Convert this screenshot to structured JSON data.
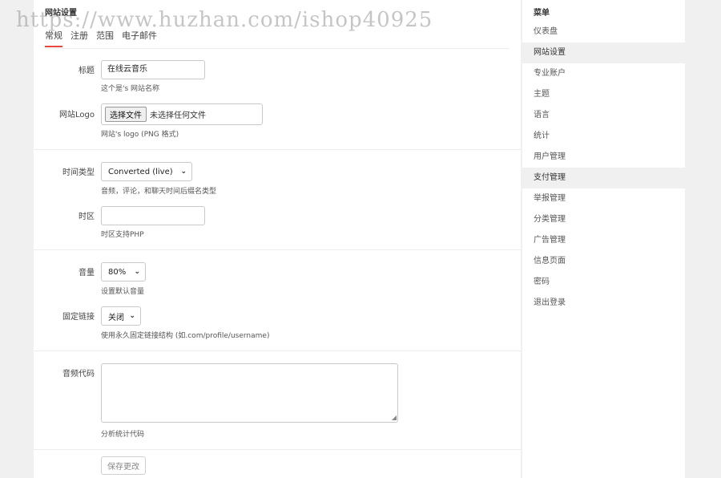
{
  "header": {
    "title": "网站设置"
  },
  "tabs": [
    {
      "label": "常规",
      "active": true
    },
    {
      "label": "注册"
    },
    {
      "label": "范围"
    },
    {
      "label": "电子邮件"
    }
  ],
  "form": {
    "title_field": {
      "label": "标题",
      "value": "在线云音乐",
      "hint": "这个是's 网站名称"
    },
    "logo_field": {
      "label": "网站Logo",
      "button": "选择文件",
      "file_text": "未选择任何文件",
      "hint": "网站's logo (PNG 格式)"
    },
    "time_type": {
      "label": "时间类型",
      "value": "Converted (live)",
      "hint": "音频，评论，和聊天时间后缀名类型"
    },
    "timezone": {
      "label": "时区",
      "value": "",
      "hint": "时区支持PHP"
    },
    "volume": {
      "label": "音量",
      "value": "80%",
      "hint": "设置默认音量"
    },
    "permalink": {
      "label": "固定链接",
      "value": "关闭",
      "hint": "使用永久固定链接结构 (如.com/profile/username)"
    },
    "audio_code": {
      "label": "音频代码",
      "value": "",
      "hint": "分析统计代码"
    },
    "save_label": "保存更改"
  },
  "sidebar": {
    "title": "菜单",
    "items": [
      {
        "label": "仪表盘"
      },
      {
        "label": "网站设置",
        "highlight": true
      },
      {
        "label": "专业账户"
      },
      {
        "label": "主题"
      },
      {
        "label": "语言"
      },
      {
        "label": "统计"
      },
      {
        "label": "用户管理"
      },
      {
        "label": "支付管理",
        "highlight": true
      },
      {
        "label": "举报管理"
      },
      {
        "label": "分类管理"
      },
      {
        "label": "广告管理"
      },
      {
        "label": "信息页面"
      },
      {
        "label": "密码"
      },
      {
        "label": "退出登录"
      }
    ]
  },
  "watermark": "https://www.huzhan.com/ishop40925",
  "colors": {
    "accent": "#e8473d",
    "background": "#f0f0f0"
  },
  "icons": {
    "select_arrow": "chevron-down-icon",
    "resize": "resize-handle-icon"
  }
}
